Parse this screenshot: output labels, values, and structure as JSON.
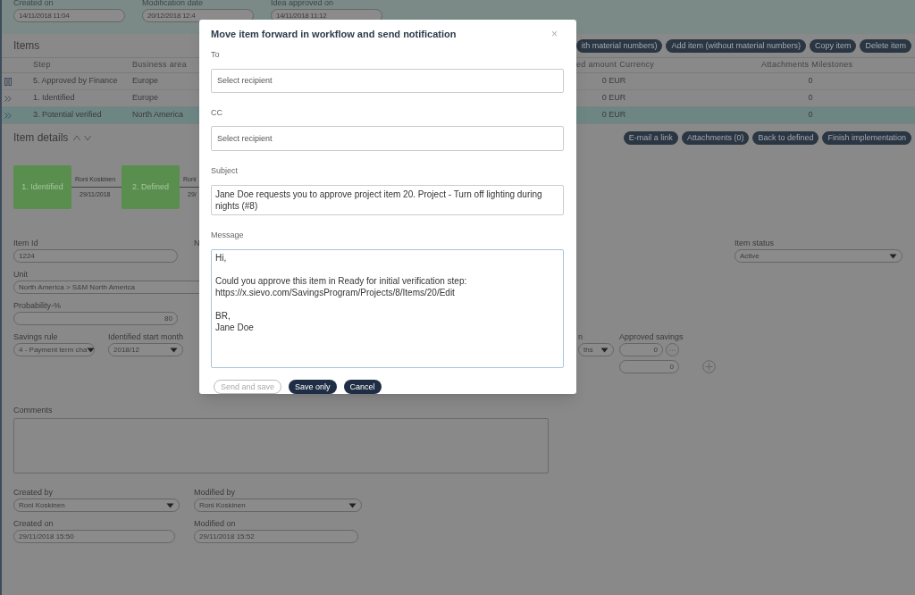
{
  "header_fields": [
    {
      "label": "Created on",
      "value": "14/11/2018 11:04"
    },
    {
      "label": "Modification date",
      "value": "20/12/2018 12:4"
    },
    {
      "label": "Idea approved on",
      "value": "14/11/2018 11:12"
    }
  ],
  "items": {
    "title": "Items",
    "buttons": [
      "ith material numbers)",
      "Add item (without material numbers)",
      "Copy item",
      "Delete item"
    ],
    "columns": [
      "Step",
      "Business area",
      "ed amount",
      "Currency",
      "Attachments",
      "Milestones"
    ],
    "rows": [
      {
        "kind": "paused",
        "step": "5. Approved by Finance",
        "business_area": "Europe",
        "amount": "0 EUR",
        "attachments": "0",
        "selected": false
      },
      {
        "kind": "forward",
        "step": "1. Identified",
        "business_area": "Europe",
        "amount": "0 EUR",
        "attachments": "0",
        "selected": false
      },
      {
        "kind": "forward",
        "step": "3. Potential verified",
        "business_area": "North America",
        "amount": "0 EUR",
        "attachments": "0",
        "selected": true
      }
    ]
  },
  "item_details": {
    "title": "Item details",
    "buttons": [
      "E-mail a link",
      "Attachments (0)",
      "Back to defined",
      "Finish implementation"
    ],
    "workflow": [
      {
        "kind": "step",
        "label": "1. Identified"
      },
      {
        "kind": "transition",
        "user": "Roni Koskinen",
        "date": "29/11/2018"
      },
      {
        "kind": "step",
        "label": "2. Defined"
      },
      {
        "kind": "transition",
        "user": "Roni",
        "date": "29/"
      }
    ]
  },
  "form": {
    "item_id": {
      "label": "Item Id",
      "value": "1224"
    },
    "column_2": {
      "label": "N"
    },
    "item_status": {
      "label": "Item status",
      "value": "Active"
    },
    "unit": {
      "label": "Unit",
      "value": "North America > S&M North America"
    },
    "probability": {
      "label": "Probability-%",
      "value": "80"
    },
    "savings_rule": {
      "label": "Savings rule",
      "value": "4 - Payment term cha"
    },
    "identified_start_month": {
      "label": "Identified start month",
      "value": "2018/12"
    },
    "column_3": {
      "label": "n",
      "value": "ths"
    },
    "approved_savings": {
      "label": "Approved savings",
      "values": [
        "0",
        "0"
      ]
    },
    "comments": {
      "label": "Comments"
    },
    "created_by": {
      "label": "Created by",
      "value": "Roni Koskinen"
    },
    "modified_by": {
      "label": "Modified by",
      "value": "Roni Koskinen"
    },
    "created_on": {
      "label": "Created on",
      "value": "29/11/2018 15:50"
    },
    "modified_on": {
      "label": "Modified on",
      "value": "29/11/2018 15:52"
    }
  },
  "dialog": {
    "title": "Move item forward in workflow and send notification",
    "close": "×",
    "to": {
      "label": "To",
      "placeholder": "Select recipient"
    },
    "cc": {
      "label": "CC",
      "placeholder": "Select recipient"
    },
    "subject": {
      "label": "Subject",
      "value": "Jane Doe requests you to approve project item 20. Project - Turn off lighting during nights (#8)"
    },
    "message": {
      "label": "Message",
      "value": "Hi,\n\nCould you approve this item in Ready for initial verification step:\nhttps://x.sievo.com/SavingsProgram/Projects/8/Items/20/Edit\n\nBR,\nJane Doe"
    },
    "buttons": [
      {
        "label": "Send and save",
        "disabled": true
      },
      {
        "label": "Save only",
        "disabled": false
      },
      {
        "label": "Cancel",
        "disabled": false
      }
    ]
  }
}
